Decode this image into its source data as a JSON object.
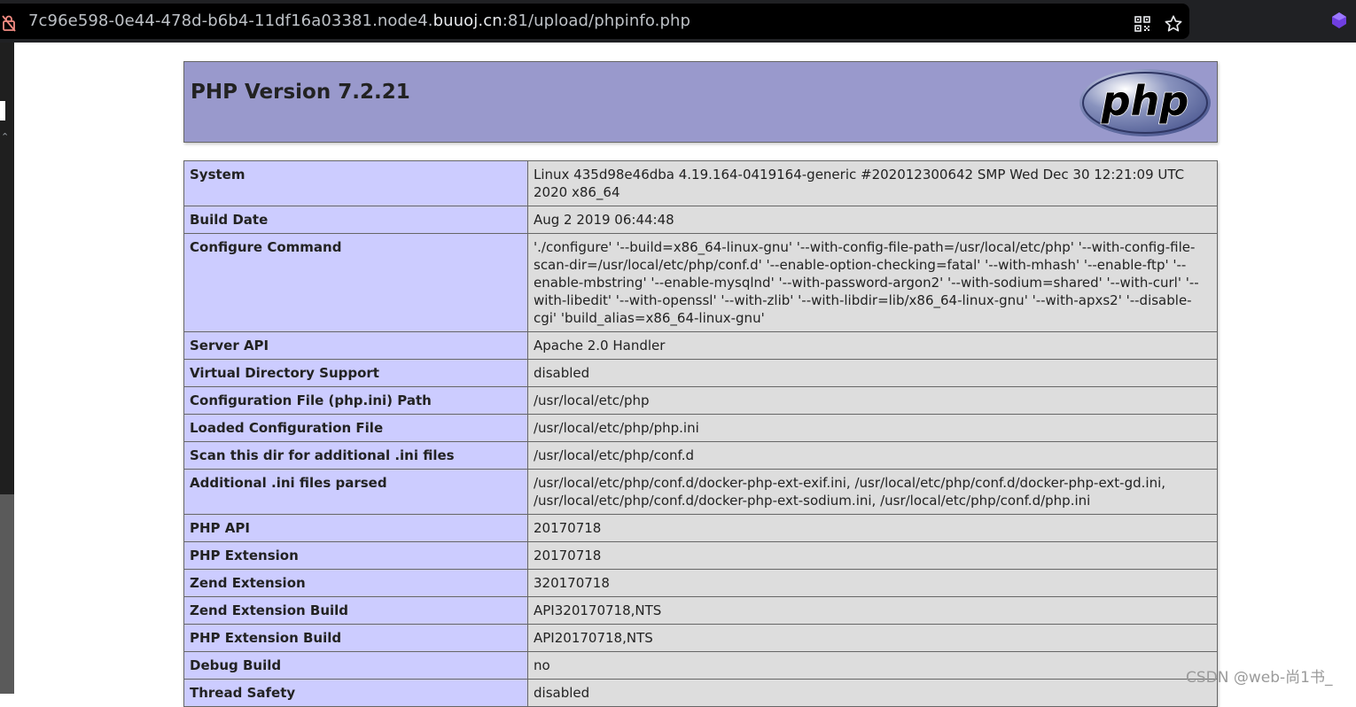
{
  "browser": {
    "url_prefix": "7c96e598-0e44-478d-b6b4-11df16a03381.node4.",
    "url_host": "buuoj.cn",
    "url_suffix": ":81/upload/phpinfo.php"
  },
  "header": {
    "title": "PHP Version 7.2.21",
    "logo_text": "php",
    "bg_color": "#9999cc"
  },
  "rows": [
    {
      "name": "System",
      "value": "Linux 435d98e46dba 4.19.164-0419164-generic #202012300642 SMP Wed Dec 30 12:21:09 UTC 2020 x86_64"
    },
    {
      "name": "Build Date",
      "value": "Aug 2 2019 06:44:48"
    },
    {
      "name": "Configure Command",
      "value": "'./configure' '--build=x86_64-linux-gnu' '--with-config-file-path=/usr/local/etc/php' '--with-config-file-scan-dir=/usr/local/etc/php/conf.d' '--enable-option-checking=fatal' '--with-mhash' '--enable-ftp' '--enable-mbstring' '--enable-mysqlnd' '--with-password-argon2' '--with-sodium=shared' '--with-curl' '--with-libedit' '--with-openssl' '--with-zlib' '--with-libdir=lib/x86_64-linux-gnu' '--with-apxs2' '--disable-cgi' 'build_alias=x86_64-linux-gnu'"
    },
    {
      "name": "Server API",
      "value": "Apache 2.0 Handler"
    },
    {
      "name": "Virtual Directory Support",
      "value": "disabled"
    },
    {
      "name": "Configuration File (php.ini) Path",
      "value": "/usr/local/etc/php"
    },
    {
      "name": "Loaded Configuration File",
      "value": "/usr/local/etc/php/php.ini"
    },
    {
      "name": "Scan this dir for additional .ini files",
      "value": "/usr/local/etc/php/conf.d"
    },
    {
      "name": "Additional .ini files parsed",
      "value": "/usr/local/etc/php/conf.d/docker-php-ext-exif.ini, /usr/local/etc/php/conf.d/docker-php-ext-gd.ini, /usr/local/etc/php/conf.d/docker-php-ext-sodium.ini, /usr/local/etc/php/conf.d/php.ini"
    },
    {
      "name": "PHP API",
      "value": "20170718"
    },
    {
      "name": "PHP Extension",
      "value": "20170718"
    },
    {
      "name": "Zend Extension",
      "value": "320170718"
    },
    {
      "name": "Zend Extension Build",
      "value": "API320170718,NTS"
    },
    {
      "name": "PHP Extension Build",
      "value": "API20170718,NTS"
    },
    {
      "name": "Debug Build",
      "value": "no"
    },
    {
      "name": "Thread Safety",
      "value": "disabled"
    }
  ],
  "watermark": "CSDN @web-尚1书_",
  "colors": {
    "label_cell": "#ccccff",
    "value_cell": "#dddddd",
    "browser_bar": "#202124"
  }
}
